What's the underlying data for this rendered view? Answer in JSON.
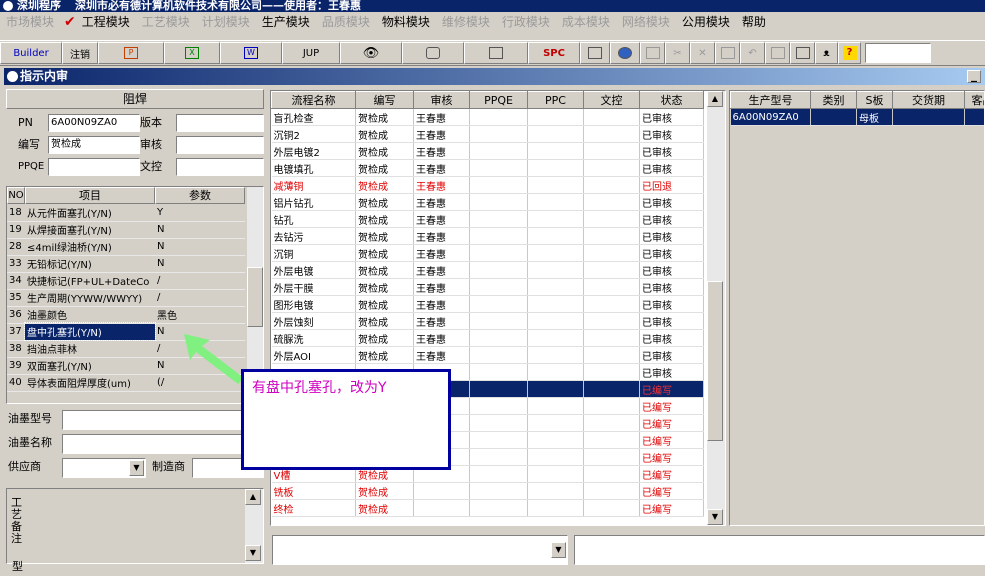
{
  "window": {
    "title": "深圳程序",
    "company": "深圳市必有德计算机软件技术有限公司——使用者：王春惠"
  },
  "menu": {
    "items": [
      {
        "label": "市场模块",
        "enabled": false
      },
      {
        "label": "工程模块",
        "enabled": true,
        "checked": true
      },
      {
        "label": "工艺模块",
        "enabled": false
      },
      {
        "label": "计划模块",
        "enabled": false
      },
      {
        "label": "生产模块",
        "enabled": true
      },
      {
        "label": "品质模块",
        "enabled": false
      },
      {
        "label": "物料模块",
        "enabled": true
      },
      {
        "label": "维修模块",
        "enabled": false
      },
      {
        "label": "行政模块",
        "enabled": false
      },
      {
        "label": "成本模块",
        "enabled": false
      },
      {
        "label": "网络模块",
        "enabled": false
      },
      {
        "label": "公用模块",
        "enabled": true
      },
      {
        "label": "帮助",
        "enabled": true
      }
    ]
  },
  "toolbar": {
    "builder": "Builder",
    "logout": "注销",
    "jup": "JUP",
    "spc": "SPC"
  },
  "subwindow": {
    "title": "指示内审"
  },
  "form": {
    "section_title": "阻焊",
    "pn_label": "PN",
    "pn_value": "6A00N09ZA0",
    "version_label": "版本",
    "version_value": "",
    "writer_label": "编写",
    "writer_value": "贺检成",
    "review_label": "审核",
    "review_value": "",
    "ppqe_label": "PPQE",
    "ppqe_value": "",
    "doc_label": "文控",
    "doc_value": ""
  },
  "params": {
    "headers": {
      "no": "NO",
      "item": "项目",
      "param": "参数"
    },
    "rows": [
      {
        "no": "18",
        "item": "从元件面塞孔(Y/N)",
        "param": "Y"
      },
      {
        "no": "19",
        "item": "从焊接面塞孔(Y/N)",
        "param": "N"
      },
      {
        "no": "28",
        "item": "≤4mil绿油桥(Y/N)",
        "param": "N"
      },
      {
        "no": "33",
        "item": "无铅标记(Y/N)",
        "param": "N"
      },
      {
        "no": "34",
        "item": "快捷标记(FP+UL+DateCo",
        "param": "/"
      },
      {
        "no": "35",
        "item": "生产周期(YYWW/WWYY)",
        "param": "/"
      },
      {
        "no": "36",
        "item": "油墨颜色",
        "param": "黑色"
      },
      {
        "no": "37",
        "item": "盘中孔塞孔(Y/N)",
        "param": "N"
      },
      {
        "no": "38",
        "item": "挡油点菲林",
        "param": "/"
      },
      {
        "no": "39",
        "item": "双面塞孔(Y/N)",
        "param": "N"
      },
      {
        "no": "40",
        "item": "导体表面阻焊厚度(um)",
        "param": "(/"
      }
    ]
  },
  "ink": {
    "type_label": "油墨型号",
    "name_label": "油墨名称",
    "supplier_label": "供应商",
    "maker_label": "制造商",
    "remark_label": "工艺备注",
    "bottom_label": "型"
  },
  "process": {
    "headers": [
      "流程名称",
      "编写",
      "审核",
      "PPQE",
      "PPC",
      "文控",
      "状态"
    ],
    "rows": [
      {
        "name": "盲孔检查",
        "writer": "贺检成",
        "reviewer": "王春惠",
        "ppqe": "",
        "ppc": "",
        "doc": "",
        "status": "已审核",
        "kind": "ok"
      },
      {
        "name": "沉铜2",
        "writer": "贺检成",
        "reviewer": "王春惠",
        "ppqe": "",
        "ppc": "",
        "doc": "",
        "status": "已审核",
        "kind": "ok"
      },
      {
        "name": "外层电镀2",
        "writer": "贺检成",
        "reviewer": "王春惠",
        "ppqe": "",
        "ppc": "",
        "doc": "",
        "status": "已审核",
        "kind": "ok"
      },
      {
        "name": "电镀填孔",
        "writer": "贺检成",
        "reviewer": "王春惠",
        "ppqe": "",
        "ppc": "",
        "doc": "",
        "status": "已审核",
        "kind": "ok"
      },
      {
        "name": "减薄铜",
        "writer": "贺检成",
        "reviewer": "王春惠",
        "ppqe": "",
        "ppc": "",
        "doc": "",
        "status": "已回退",
        "kind": "red"
      },
      {
        "name": "铝片钻孔",
        "writer": "贺检成",
        "reviewer": "王春惠",
        "ppqe": "",
        "ppc": "",
        "doc": "",
        "status": "已审核",
        "kind": "ok"
      },
      {
        "name": "钻孔",
        "writer": "贺检成",
        "reviewer": "王春惠",
        "ppqe": "",
        "ppc": "",
        "doc": "",
        "status": "已审核",
        "kind": "ok"
      },
      {
        "name": "去钻污",
        "writer": "贺检成",
        "reviewer": "王春惠",
        "ppqe": "",
        "ppc": "",
        "doc": "",
        "status": "已审核",
        "kind": "ok"
      },
      {
        "name": "沉铜",
        "writer": "贺检成",
        "reviewer": "王春惠",
        "ppqe": "",
        "ppc": "",
        "doc": "",
        "status": "已审核",
        "kind": "ok"
      },
      {
        "name": "外层电镀",
        "writer": "贺检成",
        "reviewer": "王春惠",
        "ppqe": "",
        "ppc": "",
        "doc": "",
        "status": "已审核",
        "kind": "ok"
      },
      {
        "name": "外层干膜",
        "writer": "贺检成",
        "reviewer": "王春惠",
        "ppqe": "",
        "ppc": "",
        "doc": "",
        "status": "已审核",
        "kind": "ok"
      },
      {
        "name": "图形电镀",
        "writer": "贺检成",
        "reviewer": "王春惠",
        "ppqe": "",
        "ppc": "",
        "doc": "",
        "status": "已审核",
        "kind": "ok"
      },
      {
        "name": "外层蚀刻",
        "writer": "贺检成",
        "reviewer": "王春惠",
        "ppqe": "",
        "ppc": "",
        "doc": "",
        "status": "已审核",
        "kind": "ok"
      },
      {
        "name": "硫脲洗",
        "writer": "贺检成",
        "reviewer": "王春惠",
        "ppqe": "",
        "ppc": "",
        "doc": "",
        "status": "已审核",
        "kind": "ok"
      },
      {
        "name": "外层AOI",
        "writer": "贺检成",
        "reviewer": "王春惠",
        "ppqe": "",
        "ppc": "",
        "doc": "",
        "status": "已审核",
        "kind": "ok"
      },
      {
        "name": "",
        "writer": "",
        "reviewer": "",
        "ppqe": "",
        "ppc": "",
        "doc": "",
        "status": "已审核",
        "kind": "ok"
      },
      {
        "name": "",
        "writer": "",
        "reviewer": "",
        "ppqe": "",
        "ppc": "",
        "doc": "",
        "status": "已编写",
        "kind": "sel"
      },
      {
        "name": "",
        "writer": "",
        "reviewer": "",
        "ppqe": "",
        "ppc": "",
        "doc": "",
        "status": "已编写",
        "kind": "red"
      },
      {
        "name": "",
        "writer": "",
        "reviewer": "",
        "ppqe": "",
        "ppc": "",
        "doc": "",
        "status": "已编写",
        "kind": "red"
      },
      {
        "name": "",
        "writer": "",
        "reviewer": "",
        "ppqe": "",
        "ppc": "",
        "doc": "",
        "status": "已编写",
        "kind": "red"
      },
      {
        "name": "",
        "writer": "",
        "reviewer": "",
        "ppqe": "",
        "ppc": "",
        "doc": "",
        "status": "已编写",
        "kind": "red"
      },
      {
        "name": "V槽",
        "writer": "贺检成",
        "reviewer": "",
        "ppqe": "",
        "ppc": "",
        "doc": "",
        "status": "已编写",
        "kind": "red"
      },
      {
        "name": "铣板",
        "writer": "贺检成",
        "reviewer": "",
        "ppqe": "",
        "ppc": "",
        "doc": "",
        "status": "已编写",
        "kind": "red"
      },
      {
        "name": "终检",
        "writer": "贺检成",
        "reviewer": "",
        "ppqe": "",
        "ppc": "",
        "doc": "",
        "status": "已编写",
        "kind": "red"
      }
    ]
  },
  "orders": {
    "headers": [
      "生产型号",
      "类别",
      "S板",
      "交货期",
      "客品"
    ],
    "rows": [
      {
        "model": "6A00N09ZA0",
        "category": "",
        "sboard": "母板",
        "due": "",
        "customer": ""
      }
    ]
  },
  "annotation": {
    "text": "有盘中孔塞孔，改为Y"
  },
  "colors": {
    "titlebar": "#0a246a",
    "selected": "#0a246a",
    "status_red": "#e00000",
    "annotation_text": "#d000c0",
    "annotation_border": "#0000a0",
    "arrow": "#80f080"
  }
}
